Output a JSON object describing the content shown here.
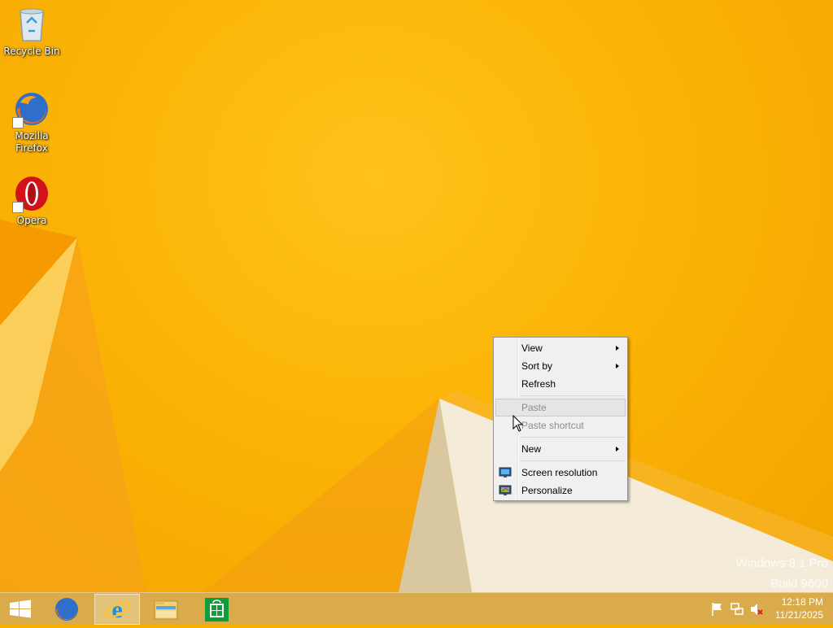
{
  "desktop": {
    "icons": [
      {
        "label": "Recycle Bin",
        "icon": "recycle-bin-icon"
      },
      {
        "label": "Mozilla Firefox",
        "icon": "firefox-icon"
      },
      {
        "label": "Opera",
        "icon": "opera-icon"
      }
    ],
    "watermark": {
      "line1": "Windows 8.1 Pro",
      "line2": "Build 9600"
    }
  },
  "context_menu": {
    "items": [
      {
        "label": "View",
        "submenu": true,
        "enabled": true
      },
      {
        "label": "Sort by",
        "submenu": true,
        "enabled": true
      },
      {
        "label": "Refresh",
        "submenu": false,
        "enabled": true
      },
      {
        "label": "Paste",
        "submenu": false,
        "enabled": false,
        "highlighted": true
      },
      {
        "label": "Paste shortcut",
        "submenu": false,
        "enabled": false
      },
      {
        "label": "New",
        "submenu": true,
        "enabled": true
      },
      {
        "label": "Screen resolution",
        "submenu": false,
        "enabled": true,
        "icon": "screen-resolution-icon"
      },
      {
        "label": "Personalize",
        "submenu": false,
        "enabled": true,
        "icon": "personalize-icon"
      }
    ]
  },
  "taskbar": {
    "buttons": [
      {
        "name": "start",
        "icon": "windows-logo-icon"
      },
      {
        "name": "firefox",
        "icon": "firefox-icon"
      },
      {
        "name": "internet-explorer",
        "icon": "internet-explorer-icon",
        "active": true
      },
      {
        "name": "file-explorer",
        "icon": "folder-icon"
      },
      {
        "name": "store",
        "icon": "store-icon"
      }
    ],
    "tray_icons": [
      "action-center-flag-icon",
      "network-icon",
      "volume-muted-icon"
    ],
    "clock": {
      "time": "12:18 PM",
      "date": "11/21/2025"
    }
  },
  "colors": {
    "wallpaper": "#f8b000",
    "menu_background": "#f0f0f0",
    "taskbar": "#d6aa50"
  }
}
